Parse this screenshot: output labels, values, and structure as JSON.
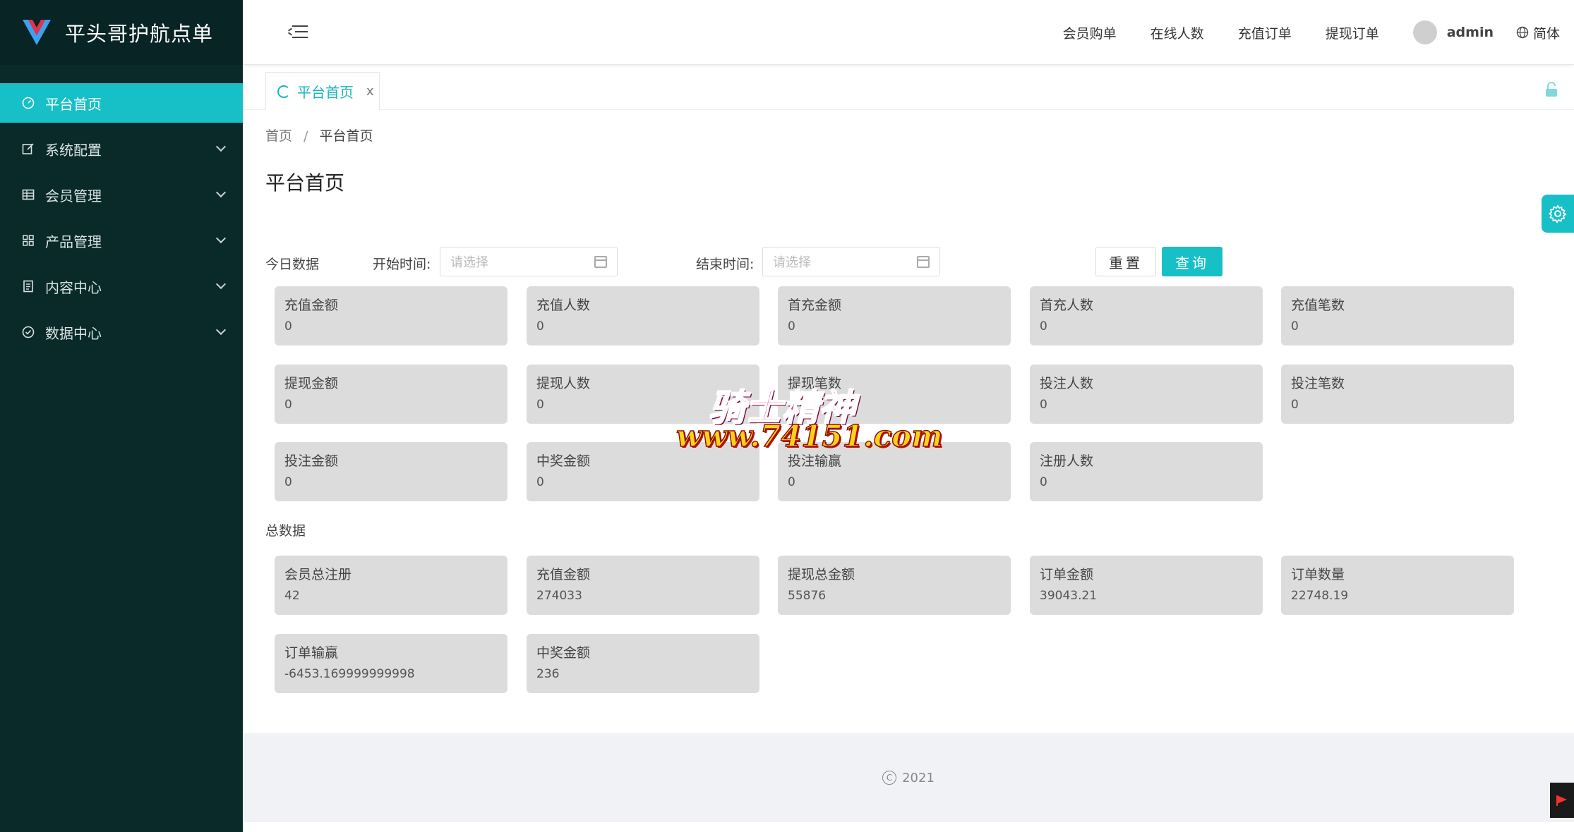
{
  "app": {
    "title": "平头哥护航点单"
  },
  "sidebar": {
    "items": [
      {
        "label": "平台首页",
        "icon": "dashboard-icon",
        "active": true
      },
      {
        "label": "系统配置",
        "icon": "edit-icon"
      },
      {
        "label": "会员管理",
        "icon": "table-icon"
      },
      {
        "label": "产品管理",
        "icon": "grid-icon"
      },
      {
        "label": "内容中心",
        "icon": "document-icon"
      },
      {
        "label": "数据中心",
        "icon": "check-circle-icon"
      }
    ]
  },
  "header": {
    "links": [
      "会员购单",
      "在线人数",
      "充值订单",
      "提现订单"
    ],
    "user": "admin",
    "lang": "简体"
  },
  "tabs": [
    {
      "label": "平台首页",
      "close": "x"
    }
  ],
  "breadcrumb": {
    "home": "首页",
    "sep": "/",
    "current": "平台首页"
  },
  "page": {
    "title": "平台首页"
  },
  "filter": {
    "section_label": "今日数据",
    "start_label": "开始时间:",
    "end_label": "结束时间:",
    "placeholder": "请选择",
    "reset": "重置",
    "query": "查询"
  },
  "today_stats": [
    {
      "label": "充值金额",
      "value": "0"
    },
    {
      "label": "充值人数",
      "value": "0"
    },
    {
      "label": "首充金额",
      "value": "0"
    },
    {
      "label": "首充人数",
      "value": "0"
    },
    {
      "label": "充值笔数",
      "value": "0"
    },
    {
      "label": "提现金额",
      "value": "0"
    },
    {
      "label": "提现人数",
      "value": "0"
    },
    {
      "label": "提现笔数",
      "value": "0"
    },
    {
      "label": "投注人数",
      "value": "0"
    },
    {
      "label": "投注笔数",
      "value": "0"
    },
    {
      "label": "投注金额",
      "value": "0"
    },
    {
      "label": "中奖金额",
      "value": "0"
    },
    {
      "label": "投注输赢",
      "value": "0"
    },
    {
      "label": "注册人数",
      "value": "0"
    }
  ],
  "total_section_label": "总数据",
  "total_stats": [
    {
      "label": "会员总注册",
      "value": "42"
    },
    {
      "label": "充值金额",
      "value": "274033"
    },
    {
      "label": "提现总金额",
      "value": "55876"
    },
    {
      "label": "订单金额",
      "value": "39043.21"
    },
    {
      "label": "订单数量",
      "value": "22748.19"
    },
    {
      "label": "订单输赢",
      "value": "-6453.169999999998"
    },
    {
      "label": "中奖金额",
      "value": "236"
    }
  ],
  "footer": {
    "text": "2021"
  },
  "watermark": {
    "line1": "骑士精神",
    "line2": "www.74151.com"
  },
  "colors": {
    "accent": "#17c0c6",
    "sidebar_bg": "#0a2a2a",
    "card_bg": "#dcdcdc"
  }
}
